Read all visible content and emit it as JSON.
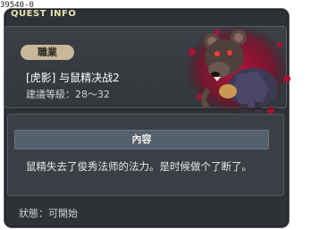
{
  "id_label": "39540-0",
  "window": {
    "title": "QUEST INFO"
  },
  "quest": {
    "job_badge": "職業",
    "title": "[虎影] 与鼠精决战2",
    "level": "建議等級：28～32",
    "portrait_icon": "rat-monster-portrait"
  },
  "content": {
    "header": "內容",
    "text": "鼠精失去了俊秀法师的法力。是时候做个了断了。"
  },
  "status": "狀態：可開始"
}
